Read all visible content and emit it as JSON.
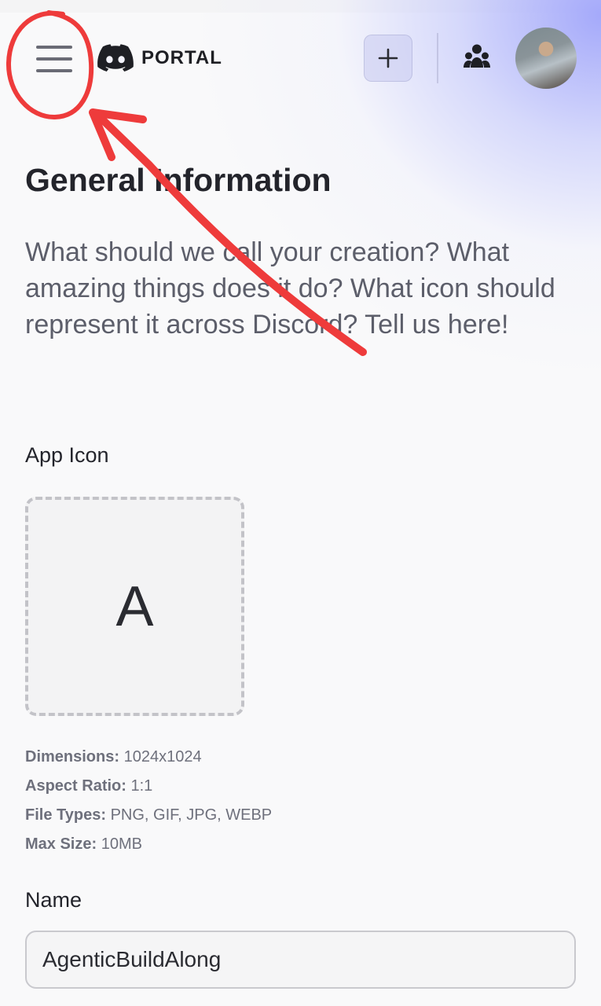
{
  "header": {
    "brand_name": "PORTAL",
    "menu_icon": "hamburger-menu-icon",
    "add_icon": "plus-icon",
    "team_icon": "people-icon",
    "avatar": "user-avatar"
  },
  "page": {
    "title": "General Information",
    "description": "What should we call your creation? What amazing things does it do? What icon should represent it across Discord? Tell us here!"
  },
  "app_icon": {
    "label": "App Icon",
    "placeholder_letter": "A",
    "specs": [
      {
        "key": "Dimensions:",
        "value": "1024x1024"
      },
      {
        "key": "Aspect Ratio:",
        "value": "1:1"
      },
      {
        "key": "File Types:",
        "value": "PNG, GIF, JPG, WEBP"
      },
      {
        "key": "Max Size:",
        "value": "10MB"
      }
    ]
  },
  "name_field": {
    "label": "Name",
    "value": "AgenticBuildAlong"
  },
  "colors": {
    "annotation_red": "#ee3b3b",
    "gradient_accent": "#a0a5fa"
  }
}
